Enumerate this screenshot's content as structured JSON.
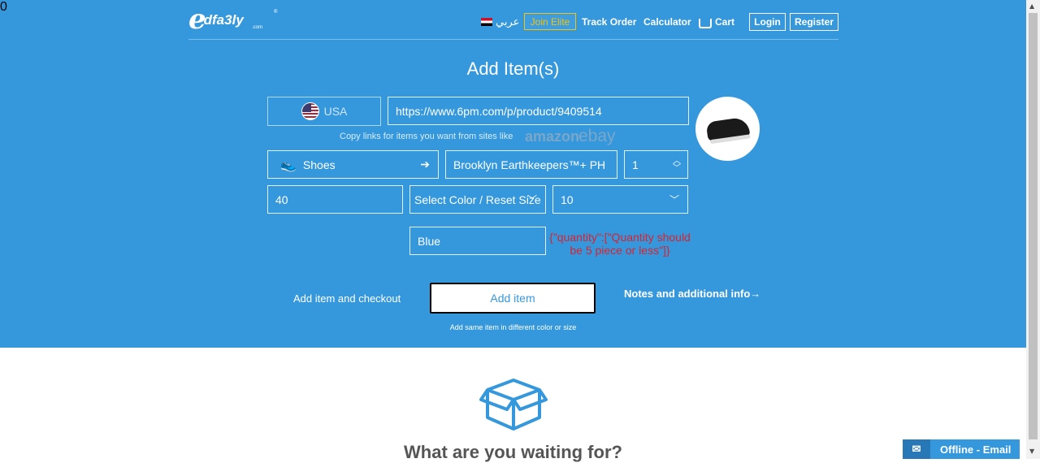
{
  "header": {
    "logo_e": "e",
    "logo_text": "dfa3ly",
    "logo_com": ".com",
    "logo_tm": "®",
    "language": "عربي",
    "join_elite": "Join Elite",
    "track_order": "Track Order",
    "calculator": "Calculator",
    "cart_count": "0",
    "cart": "Cart",
    "login": "Login",
    "register": "Register"
  },
  "form": {
    "title": "Add Item(s)",
    "country": "USA",
    "url": "https://www.6pm.com/p/product/9409514",
    "hint": "Copy links for items you want from sites like",
    "site1": "amazon",
    "site2": "ebay",
    "category": "Shoes",
    "item_name": "Brooklyn Earthkeepers™+ PH",
    "quantity": "1",
    "size": "40",
    "color_select": "Select Color / Reset Size",
    "length": "10",
    "color_value": "Blue",
    "error": "{\"quantity\":[\"Quantity should be 5 piece or less\"]}",
    "checkout_label": "Add item and checkout",
    "add_item_label": "Add item",
    "notes_label": "Notes and additional info",
    "same_item_label": "Add same item in different color or size"
  },
  "promo": {
    "heading": "What are you waiting for?"
  },
  "chat": {
    "offline_label": "Offline - Email"
  },
  "colors": {
    "brand_blue": "#3598dc",
    "elite_gold": "#f1c40f",
    "error_red": "#d9232e"
  }
}
